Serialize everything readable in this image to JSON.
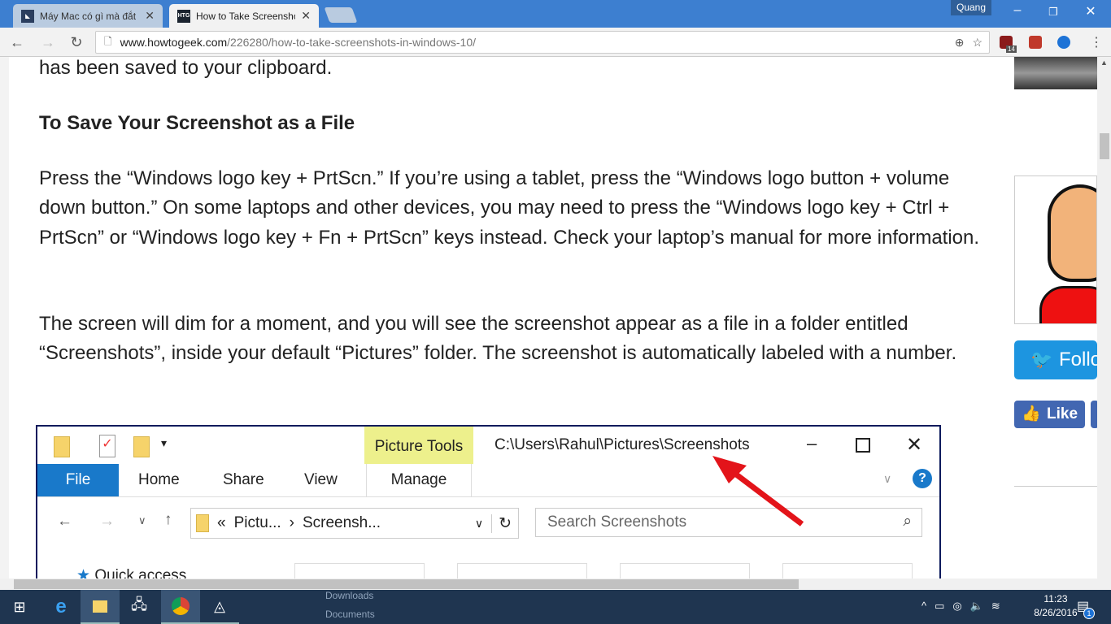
{
  "browser": {
    "tabs": [
      {
        "title": "Máy Mac có gì mà đắt h",
        "favicon": "site-logo"
      },
      {
        "title": "How to Take Screenshot",
        "favicon": "HTG"
      }
    ],
    "user": "Quang",
    "url_host": "www.howtogeek.com",
    "url_path": "/226280/how-to-take-screenshots-in-windows-10/",
    "extension_badge": "14"
  },
  "article": {
    "p0": "has been saved to your clipboard.",
    "heading": "To Save Your Screenshot as a File",
    "p1": "Press the “Windows logo key + PrtScn.” If you’re using a tablet, press the “Windows logo button + volume down button.” On some laptops and other devices, you may need to press the “Windows logo key + Ctrl + PrtScn” or “Windows logo key + Fn + PrtScn” keys instead. Check your laptop’s manual for more information.",
    "p2": "The screen will dim for a moment, and you will see the screenshot appear as a file in a folder entitled “Screenshots”, inside your default “Pictures” folder. The screenshot is automatically labeled with a number."
  },
  "explorer": {
    "title_path": "C:\\Users\\Rahul\\Pictures\\Screenshots",
    "picture_tools": "Picture Tools",
    "ribbon_tabs": [
      "File",
      "Home",
      "Share",
      "View",
      "Manage"
    ],
    "breadcrumb": [
      "«",
      "Pictu...",
      "›",
      "Screensh..."
    ],
    "search_placeholder": "Search Screenshots",
    "nav_quick_access": "Quick access"
  },
  "sidebar": {
    "follow": "Follo",
    "like": "Like"
  },
  "taskbar": {
    "time": "11:23",
    "date": "8/26/2016",
    "notification_count": "1",
    "ghost_items": [
      "Downloads",
      "Documents"
    ]
  }
}
